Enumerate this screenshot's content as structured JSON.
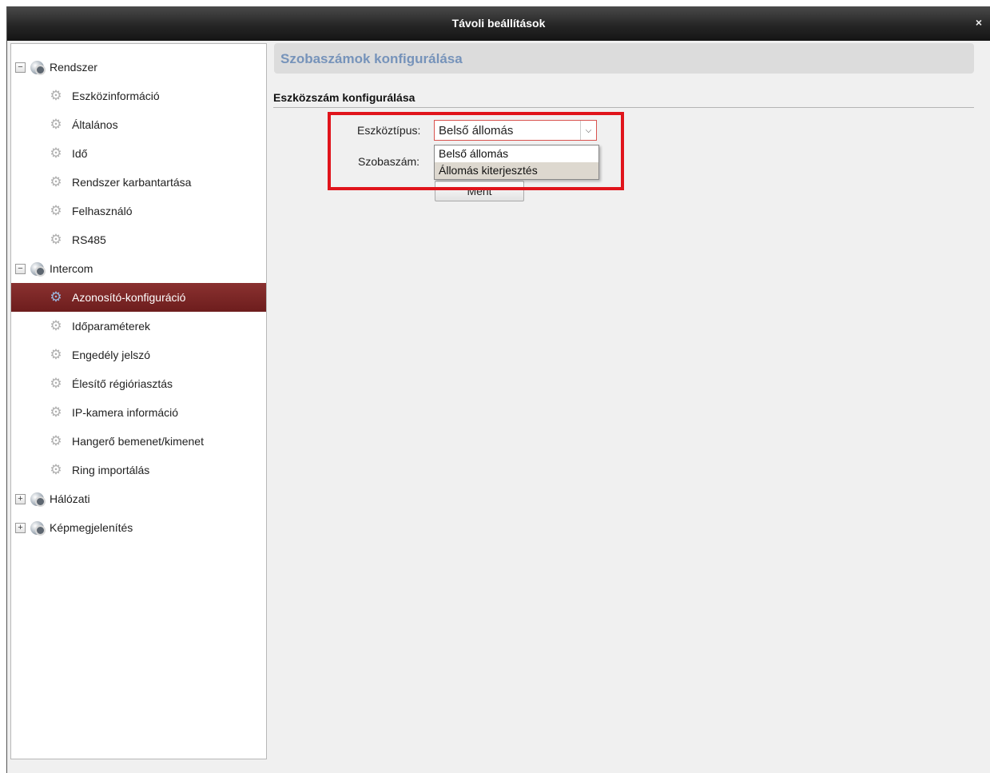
{
  "window": {
    "title": "Távoli beállítások",
    "close_label": "×"
  },
  "sidebar": {
    "groups": [
      {
        "label": "Rendszer",
        "expander": "−",
        "items": [
          "Eszközinformáció",
          "Általános",
          "Idő",
          "Rendszer karbantartása",
          "Felhasználó",
          "RS485"
        ]
      },
      {
        "label": "Intercom",
        "expander": "−",
        "items": [
          "Azonosító-konfiguráció",
          "Időparaméterek",
          "Engedély jelszó",
          "Élesítő régióriasztás",
          "IP-kamera információ",
          "Hangerő bemenet/kimenet",
          "Ring importálás"
        ]
      },
      {
        "label": "Hálózati",
        "expander": "+",
        "items": []
      },
      {
        "label": "Képmegjelenítés",
        "expander": "+",
        "items": []
      }
    ],
    "selected": "Azonosító-konfiguráció"
  },
  "main": {
    "header": "Szobaszámok konfigurálása",
    "section_title": "Eszközszám konfigurálása",
    "device_type_label": "Eszköztípus:",
    "device_type_value": "Belső állomás",
    "room_number_label": "Szobaszám:",
    "save_label": "Ment",
    "dropdown_options": [
      "Belső állomás",
      "Állomás kiterjesztés"
    ],
    "highlighted_option": "Állomás kiterjesztés"
  },
  "colors": {
    "selected_row": "#7a2424",
    "header_text": "#7693ba",
    "highlight_frame": "#e0141b"
  },
  "icons": {
    "group_icon": "globe-gear-icon",
    "item_icon": "gear-icon",
    "dropdown_icon": "chevron-down-icon",
    "close_icon": "close-icon"
  }
}
